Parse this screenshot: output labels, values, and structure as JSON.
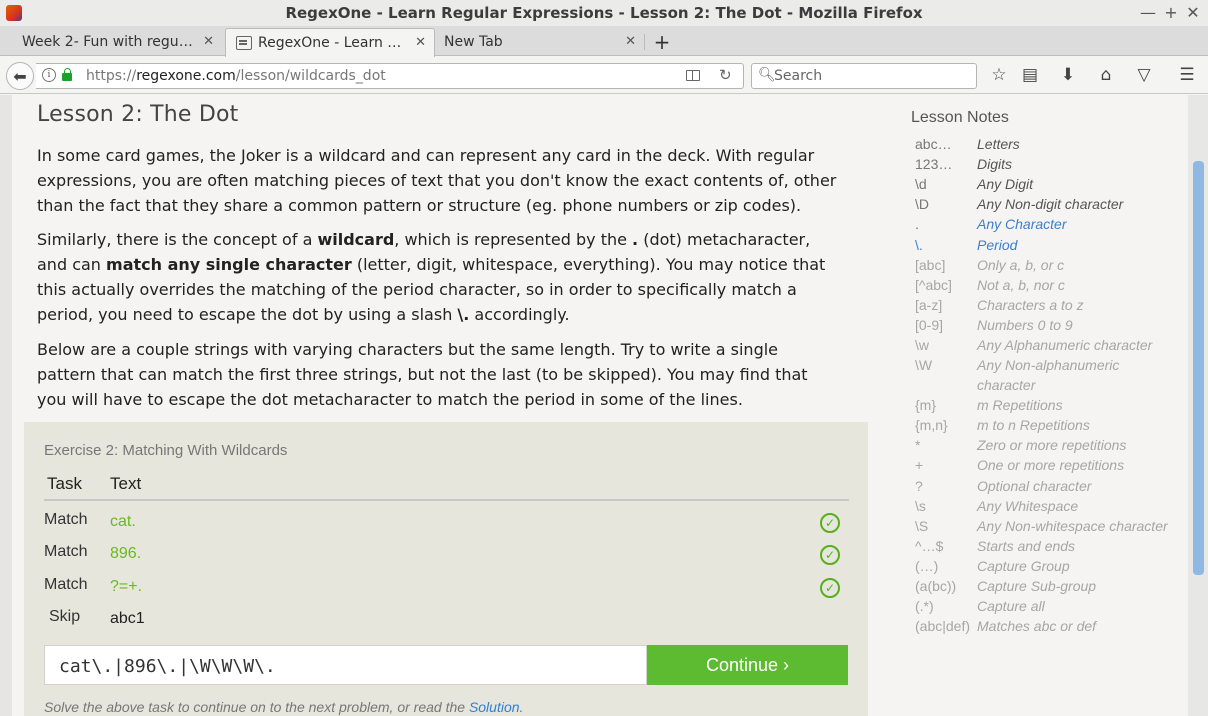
{
  "window": {
    "title": "RegexOne - Learn Regular Expressions - Lesson 2: The Dot - Mozilla Firefox",
    "controls": [
      "—",
      "+",
      "✕"
    ]
  },
  "tabs": [
    {
      "label": "Week 2- Fun with regul...",
      "active": false
    },
    {
      "label": "RegexOne - Learn R...",
      "active": true
    },
    {
      "label": "New Tab",
      "active": false
    }
  ],
  "nav": {
    "url_scheme": "https://",
    "url_host": "regexone.com",
    "url_path": "/lesson/wildcards_dot",
    "search_placeholder": "Search"
  },
  "lesson": {
    "title": "Lesson 2: The Dot",
    "para1": "In some card games, the Joker is a wildcard and can represent any card in the deck. With regular expressions, you are often matching pieces of text that you don't know the exact contents of, other than the fact that they share a common pattern or structure (eg. phone numbers or zip codes).",
    "para2_a": "Similarly, there is the concept of a ",
    "para2_b": "wildcard",
    "para2_c": ", which is represented by the ",
    "para2_d": ".",
    "para2_e": " (dot) metacharacter, and can ",
    "para2_f": "match any single character",
    "para2_g": " (letter, digit, whitespace, everything). You may notice that this actually overrides the matching of the period character, so in order to specifically match a period, you need to escape the dot by using a slash ",
    "para2_h": "\\.",
    "para2_i": " accordingly.",
    "para3": "Below are a couple strings with varying characters but the same length. Try to write a single pattern that can match the first three strings, but not the last (to be skipped). You may find that you will have to escape the dot metacharacter to match the period in some of the lines."
  },
  "exercise": {
    "title": "Exercise 2: Matching With Wildcards",
    "col_task": "Task",
    "col_text": "Text",
    "rows": [
      {
        "task": "Match",
        "text": "cat.",
        "ok": true
      },
      {
        "task": "Match",
        "text": "896.",
        "ok": true
      },
      {
        "task": "Match",
        "text": "?=+.",
        "ok": true
      },
      {
        "task": "Skip",
        "text": "abc1",
        "ok": false
      }
    ],
    "answer": "cat\\.|896\\.|\\W\\W\\W\\.",
    "continue_label": "Continue ›",
    "footer_a": "Solve the above task to continue on to the next problem, or read the ",
    "footer_link": "Solution",
    "footer_b": "."
  },
  "notes": {
    "title": "Lesson Notes",
    "items": [
      {
        "k": "abc…",
        "v": "Letters",
        "state": "normal"
      },
      {
        "k": "123…",
        "v": "Digits",
        "state": "normal"
      },
      {
        "k": "\\d",
        "v": "Any Digit",
        "state": "normal"
      },
      {
        "k": "\\D",
        "v": "Any Non-digit character",
        "state": "normal"
      },
      {
        "k": ".",
        "v": "Any Character",
        "state": "hl"
      },
      {
        "k": "\\.",
        "v": "Period",
        "state": "hl"
      },
      {
        "k": "[abc]",
        "v": "Only a, b, or c",
        "state": "dim"
      },
      {
        "k": "[^abc]",
        "v": "Not a, b, nor c",
        "state": "dim"
      },
      {
        "k": "[a-z]",
        "v": "Characters a to z",
        "state": "dim"
      },
      {
        "k": "[0-9]",
        "v": "Numbers 0 to 9",
        "state": "dim"
      },
      {
        "k": "\\w",
        "v": "Any Alphanumeric character",
        "state": "dim"
      },
      {
        "k": "\\W",
        "v": "Any Non-alphanumeric character",
        "state": "dim"
      },
      {
        "k": "{m}",
        "v": "m Repetitions",
        "state": "dim"
      },
      {
        "k": "{m,n}",
        "v": "m to n Repetitions",
        "state": "dim"
      },
      {
        "k": "*",
        "v": "Zero or more repetitions",
        "state": "dim"
      },
      {
        "k": "+",
        "v": "One or more repetitions",
        "state": "dim"
      },
      {
        "k": "?",
        "v": "Optional character",
        "state": "dim"
      },
      {
        "k": "\\s",
        "v": "Any Whitespace",
        "state": "dim"
      },
      {
        "k": "\\S",
        "v": "Any Non-whitespace character",
        "state": "dim"
      },
      {
        "k": "^…$",
        "v": "Starts and ends",
        "state": "dim"
      },
      {
        "k": "(…)",
        "v": "Capture Group",
        "state": "dim"
      },
      {
        "k": "(a(bc))",
        "v": "Capture Sub-group",
        "state": "dim"
      },
      {
        "k": "(.*)",
        "v": "Capture all",
        "state": "dim"
      },
      {
        "k": "(abc|def)",
        "v": "Matches abc or def",
        "state": "dim"
      }
    ]
  }
}
